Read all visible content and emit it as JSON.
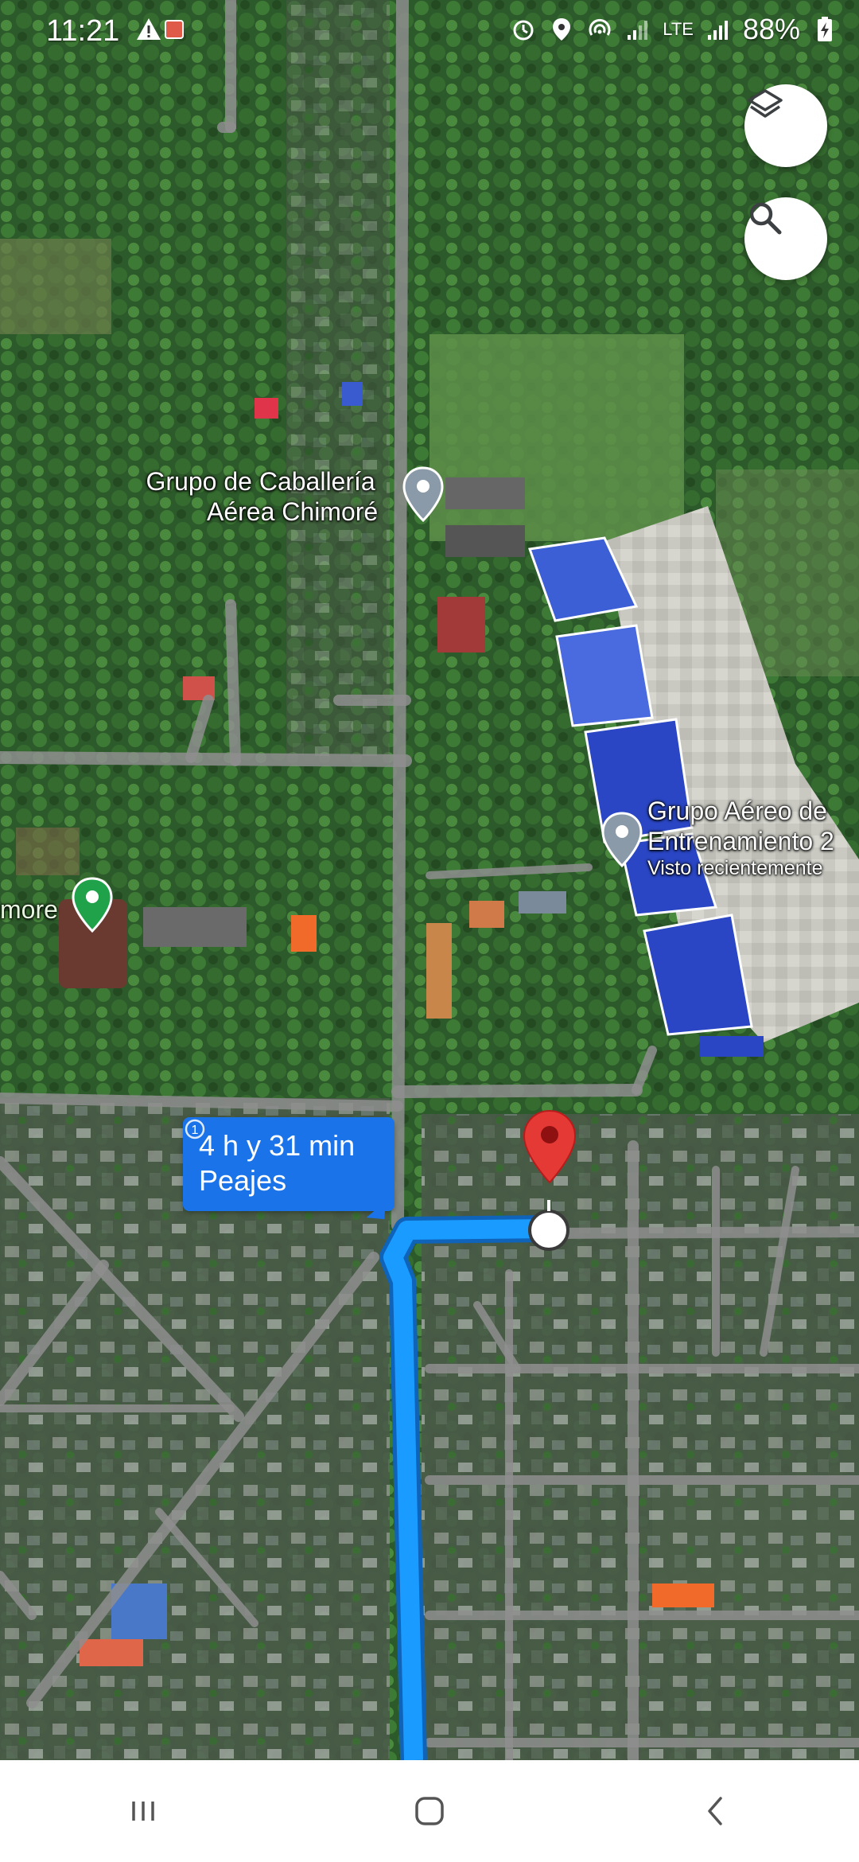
{
  "status_bar": {
    "time": "11:21",
    "network": "LTE",
    "battery": "88%"
  },
  "map": {
    "places": [
      {
        "line1": "Grupo de Caballería",
        "line2": "Aérea Chimoré"
      },
      {
        "line1": "Grupo Aéreo de",
        "line2": "Entrenamiento 2",
        "line3": "Visto recientemente"
      },
      {
        "line1": "more"
      }
    ],
    "route": {
      "duration": "4 h y 31 min",
      "tolls": "Peajes"
    },
    "colors": {
      "route": "#1a9bff",
      "bubble": "#1a73e8",
      "destination_pin": "#e53935",
      "place_pin_gray": "#8a9aa8",
      "place_pin_green": "#1fa24a"
    }
  },
  "buttons": {
    "layers": "layers-icon",
    "search": "search-icon"
  },
  "nav": {
    "recents": "recents-icon",
    "home": "home-icon",
    "back": "back-icon"
  }
}
